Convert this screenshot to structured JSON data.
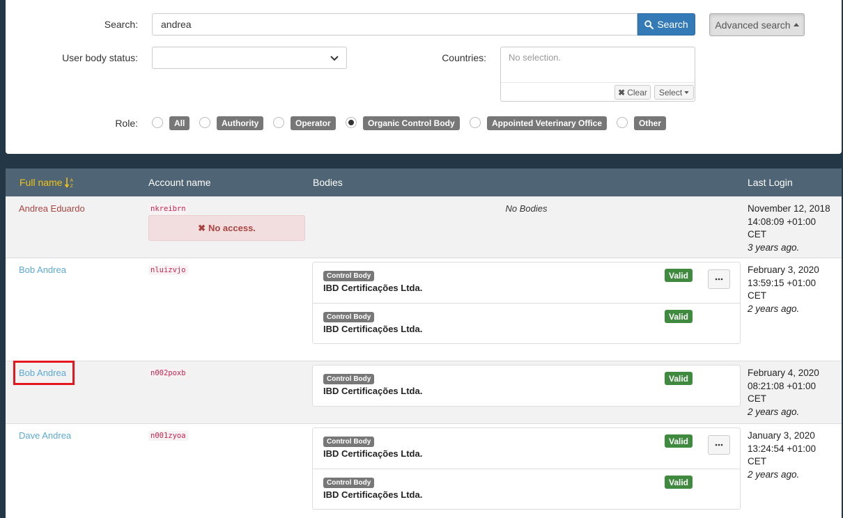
{
  "search": {
    "label": "Search:",
    "value": "andrea",
    "button_label": "Search",
    "advanced_label": "Advanced search"
  },
  "filters": {
    "user_body_status_label": "User body status:",
    "user_body_status_value": "",
    "countries_label": "Countries:",
    "countries_placeholder": "No selection.",
    "clear_label": "Clear",
    "select_label": "Select",
    "role_label": "Role:",
    "roles": [
      {
        "label": "All",
        "checked": false
      },
      {
        "label": "Authority",
        "checked": false
      },
      {
        "label": "Operator",
        "checked": false
      },
      {
        "label": "Organic Control Body",
        "checked": true
      },
      {
        "label": "Appointed Veterinary Office",
        "checked": false
      },
      {
        "label": "Other",
        "checked": false
      }
    ]
  },
  "table": {
    "headers": {
      "full_name": "Full name",
      "account_name": "Account name",
      "bodies": "Bodies",
      "last_login": "Last Login"
    },
    "rows": [
      {
        "full_name": "Andrea Eduardo",
        "account": "nkreibrn",
        "no_access": "No access.",
        "no_bodies": "No Bodies",
        "login_date": "November 12, 2018",
        "login_time": "14:08:09 +01:00",
        "login_tz": "CET",
        "login_ago": "3 years ago."
      },
      {
        "full_name": "Bob Andrea",
        "account": "nluizvjo",
        "bodies": [
          {
            "tag": "Control Body",
            "name": "IBD Certificações Ltda.",
            "status": "Valid"
          },
          {
            "tag": "Control Body",
            "name": "IBD Certificações Ltda.",
            "status": "Valid"
          }
        ],
        "login_date": "February 3, 2020",
        "login_time": "13:59:15 +01:00",
        "login_tz": "CET",
        "login_ago": "2 years ago."
      },
      {
        "full_name": "Bob Andrea",
        "account": "n002poxb",
        "bodies": [
          {
            "tag": "Control Body",
            "name": "IBD Certificações Ltda.",
            "status": "Valid"
          }
        ],
        "login_date": "February 4, 2020",
        "login_time": "08:21:08 +01:00",
        "login_tz": "CET",
        "login_ago": "2 years ago."
      },
      {
        "full_name": "Dave Andrea",
        "account": "n001zyoa",
        "bodies": [
          {
            "tag": "Control Body",
            "name": "IBD Certificações Ltda.",
            "status": "Valid"
          },
          {
            "tag": "Control Body",
            "name": "IBD Certificações Ltda.",
            "status": "Valid"
          }
        ],
        "login_date": "January 3, 2020",
        "login_time": "13:24:54 +01:00",
        "login_tz": "CET",
        "login_ago": "2 years ago."
      }
    ]
  },
  "colors": {
    "background": "#233746",
    "header_bg": "#4f6474",
    "sorted_header": "#f0c419",
    "link": "#5aa9d6",
    "valid": "#3f8a3f",
    "highlight": "#e3171d"
  }
}
